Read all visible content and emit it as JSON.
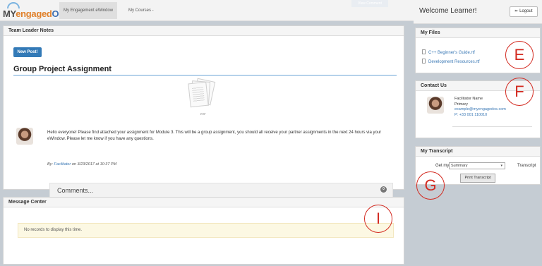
{
  "app": {
    "logo": {
      "my": "MY",
      "engaged": "engaged",
      "os": "OS"
    }
  },
  "nav": {
    "tabs": [
      {
        "label": "My Engagement eWindow"
      },
      {
        "label": "My Courses -"
      }
    ],
    "view_button": "View Comment"
  },
  "header": {
    "welcome": "Welcome Learner!",
    "logout_label": "Logout"
  },
  "team_notes": {
    "title": "Team Leader Notes",
    "new_post_label": "New Post!",
    "post": {
      "title": "Group Project Assignment",
      "attachment_caption": "RTF",
      "body": "Hello everyone! Please find attached your assignment for Module 3. This will be a group assignment, you should all receive your partner assignments in the next 24 hours via your eWindow. Please let me know if you have any questions.",
      "by_prefix": "By:",
      "author": "Facilitator",
      "timestamp": "on 3/23/2017 at 10:37 PM"
    },
    "comments": {
      "label": "Comments...",
      "count": "0"
    }
  },
  "message_center": {
    "title": "Message Center",
    "empty_text": "No records to display this time."
  },
  "my_files": {
    "title": "My Files",
    "files": [
      {
        "name": "C++ Beginner's Guide.rtf"
      },
      {
        "name": "Development Resources.rtf"
      }
    ]
  },
  "contact_us": {
    "title": "Contact Us",
    "name": "Facilitator Name",
    "role": "Primary",
    "email": "example@myengagedos.com",
    "phone": "P: +33 001 110010"
  },
  "transcript": {
    "title": "My Transcript",
    "get_my": "Get my",
    "selected": "Summary",
    "suffix": "Transcript",
    "print_label": "Print Transcript"
  },
  "markers": {
    "e": "E",
    "f": "F",
    "g": "G",
    "i": "I"
  },
  "colors": {
    "accent": "#337ab7",
    "marker": "#d32a20",
    "alert_bg": "#fcf8e3"
  },
  "icons": {
    "logout": "logout-icon",
    "file": "file-icon",
    "avatar": "avatar"
  }
}
